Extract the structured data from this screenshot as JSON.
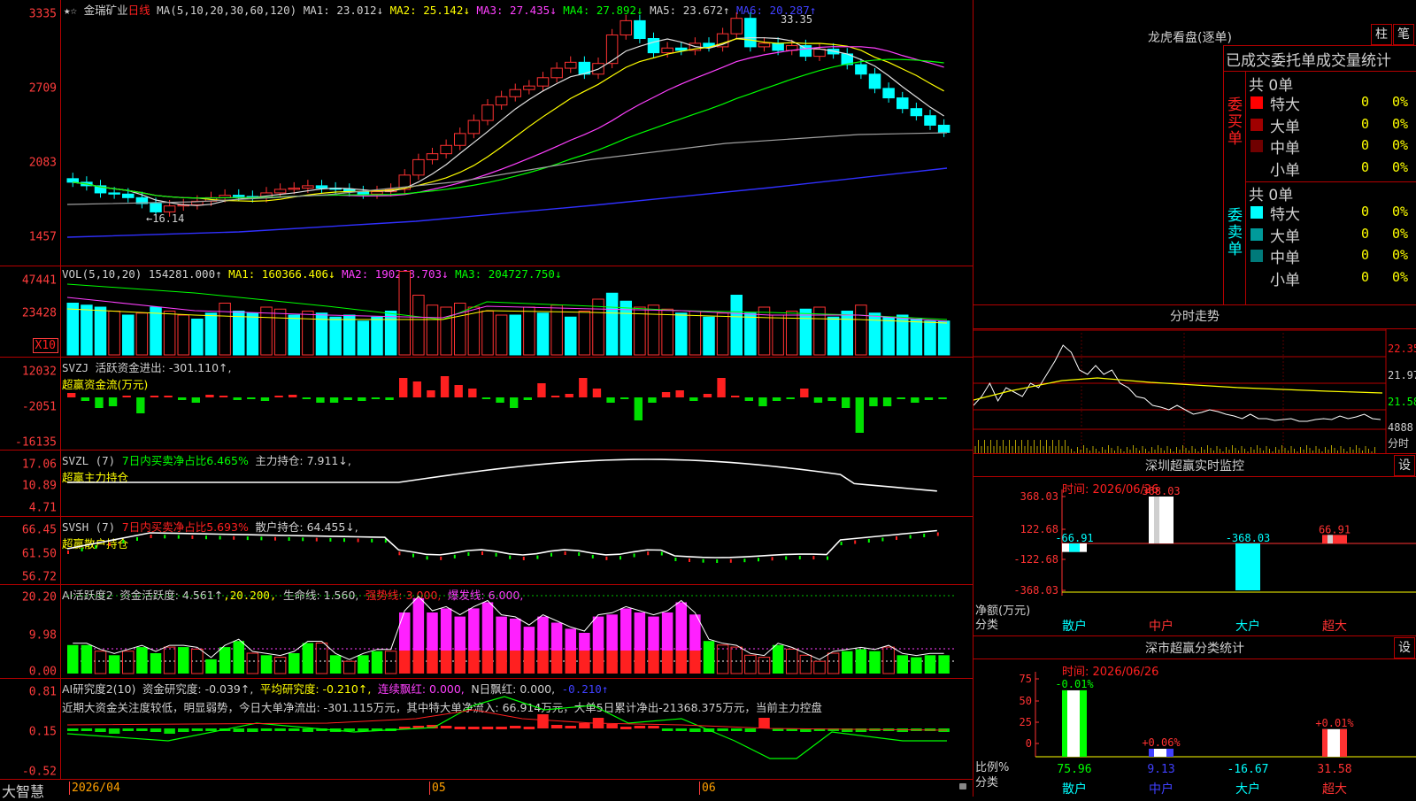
{
  "stock": {
    "name": "金瑞矿业",
    "period": "日线"
  },
  "kline": {
    "ma_header": {
      "label": "MA(5,10,20,30,60,120)",
      "ma1": "MA1: 23.012↓",
      "ma2": "MA2: 25.142↓",
      "ma3": "MA3: 27.435↓",
      "ma4": "MA4: 27.892↓",
      "ma5": "MA5: 23.672↑",
      "ma6": "MA6: 20.287↑"
    },
    "yticks": [
      "3335",
      "2709",
      "2083",
      "1457"
    ],
    "high_label": "33.35",
    "low_label": "←16.14"
  },
  "vol": {
    "header": {
      "label": "VOL(5,10,20)",
      "value": "154281.000↑",
      "ma1": "MA1: 160366.406↓",
      "ma2": "MA2: 190268.703↓",
      "ma3": "MA3: 204727.750↓"
    },
    "yticks": [
      "47441",
      "23428"
    ],
    "unit": "X10"
  },
  "svzj": {
    "header": {
      "label": "SVZJ",
      "text": "活跃资金进出: -301.110↑,"
    },
    "subtitle": "超赢资金流(万元)",
    "yticks": [
      "12032",
      "-2051",
      "-16135"
    ]
  },
  "svzl": {
    "header": {
      "label": "SVZL (7)",
      "text1": "7日内买卖净占比6.465%",
      "text2": "主力持仓: 7.911↓,"
    },
    "subtitle": "超赢主力持仓",
    "yticks": [
      "17.06",
      "10.89",
      "4.71"
    ]
  },
  "svsh": {
    "header": {
      "label": "SVSH (7)",
      "text1": "7日内买卖净占比5.693%",
      "text2": "散户持仓: 64.455↓,"
    },
    "subtitle": "超赢散户持仓",
    "yticks": [
      "66.45",
      "61.50",
      "56.72"
    ]
  },
  "ai_act": {
    "header": {
      "label": "AI活跃度2",
      "t1": "资金活跃度: 4.561↑",
      "t2": ",20.200,",
      "t3": "生命线: 1.560,",
      "t4": "强势线: 3.000,",
      "t5": "爆发线: 6.000,"
    },
    "yticks": [
      "20.20",
      "9.98",
      "0.00"
    ]
  },
  "ai_res": {
    "header": {
      "label": "AI研究度2(10)",
      "t1": "资金研究度: -0.039↑,",
      "t2": "平均研究度: -0.210↑,",
      "t3": "连续飘红: 0.000,",
      "t4": "N日飘红: 0.000,",
      "t5": "-0.210↑"
    },
    "note": "近期大资金关注度较低，明显弱势，今日大单净流出: -301.115万元，其中特大单净流入: 66.914万元，大单5日累计净出-21368.375万元，当前主力控盘",
    "yticks": [
      "0.81",
      "0.15",
      "-0.52"
    ]
  },
  "bottom": {
    "brand": "大智慧",
    "dates": [
      "2026/04",
      "05",
      "06"
    ]
  },
  "lhb": {
    "title": "龙虎看盘(逐单)",
    "btn_zhu": "柱",
    "btn_bi": "笔",
    "table_title": "已成交委托单成交量统计",
    "buy_label": "委买单",
    "sell_label": "委卖单",
    "buy_total": "共 0单",
    "sell_total": "共 0单",
    "buy_rows": [
      {
        "name": "特大",
        "count": "0",
        "pct": "0%",
        "color": "#ff0000"
      },
      {
        "name": "大单",
        "count": "0",
        "pct": "0%",
        "color": "#a00000"
      },
      {
        "name": "中单",
        "count": "0",
        "pct": "0%",
        "color": "#700000"
      },
      {
        "name": "小单",
        "count": "0",
        "pct": "0%",
        "color": "#000000"
      }
    ],
    "sell_rows": [
      {
        "name": "特大",
        "count": "0",
        "pct": "0%",
        "color": "#00ffff"
      },
      {
        "name": "大单",
        "count": "0",
        "pct": "0%",
        "color": "#009a9a"
      },
      {
        "name": "中单",
        "count": "0",
        "pct": "0%",
        "color": "#007a7a"
      },
      {
        "name": "小单",
        "count": "0",
        "pct": "0%",
        "color": "#000000"
      }
    ]
  },
  "fenshi": {
    "title": "分时走势",
    "yticks": [
      "22.35",
      "21.97",
      "21.58"
    ],
    "vol_label": "4888",
    "vol_unit": "分时"
  },
  "sz_monitor": {
    "title": "深圳超赢实时监控",
    "settings": "设",
    "time": "时间: 2026/06/26",
    "yticks": [
      "368.03",
      "122.68",
      "-122.68",
      "-368.03"
    ],
    "ylabel1": "净额(万元)",
    "ylabel2": "分类",
    "categories": [
      "散户",
      "中户",
      "大户",
      "超大"
    ],
    "bar_values": [
      -66.91,
      368.03,
      -368.03,
      66.91
    ],
    "bar_labels": [
      "-66.91",
      "368.03",
      "-368.03",
      "66.91"
    ]
  },
  "sz_class": {
    "title": "深市超赢分类统计",
    "settings": "设",
    "time": "时间: 2026/06/26",
    "yticks": [
      "75",
      "50",
      "25",
      "0"
    ],
    "ylabel1": "比例%",
    "ylabel2": "分类",
    "categories": [
      "散户",
      "中户",
      "大户",
      "超大"
    ],
    "values": [
      "75.96",
      "9.13",
      "-16.67",
      "31.58"
    ],
    "bar_heights": [
      75.96,
      9.13,
      0,
      31.58
    ],
    "changes": [
      "-0.01%",
      "+0.06%",
      "",
      "+0.01%"
    ]
  }
}
